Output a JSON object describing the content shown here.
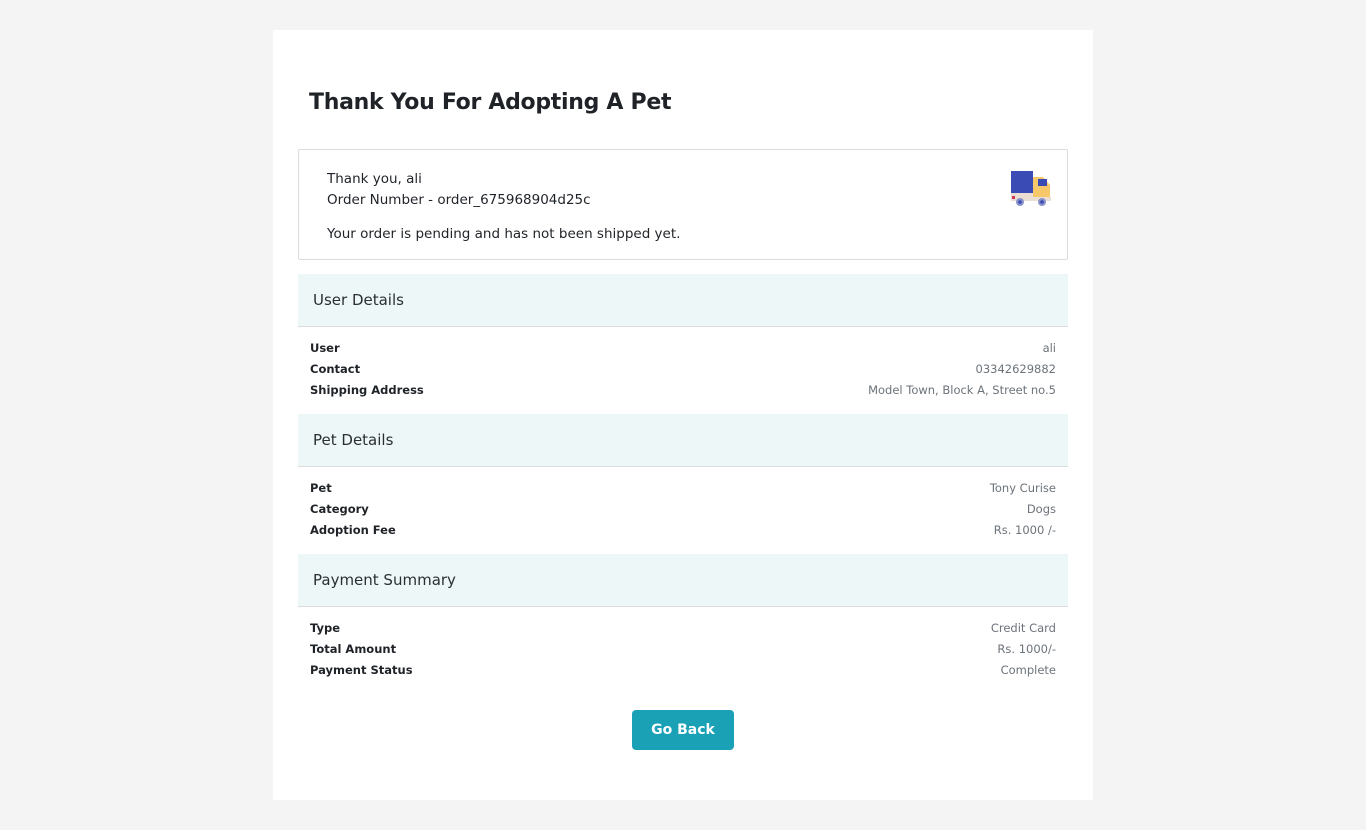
{
  "page": {
    "title": "Thank You For Adopting A Pet"
  },
  "order": {
    "thank_you": "Thank you, ali",
    "order_number": "Order Number - order_675968904d25c",
    "status_message": "Your order is pending and has not been shipped yet.",
    "icon": "delivery-truck-icon"
  },
  "user_details": {
    "heading": "User Details",
    "rows": [
      {
        "label": "User",
        "value": "ali"
      },
      {
        "label": "Contact",
        "value": "03342629882"
      },
      {
        "label": "Shipping Address",
        "value": "Model Town, Block A, Street no.5"
      }
    ]
  },
  "pet_details": {
    "heading": "Pet Details",
    "rows": [
      {
        "label": "Pet",
        "value": "Tony Curise"
      },
      {
        "label": "Category",
        "value": "Dogs"
      },
      {
        "label": "Adoption Fee",
        "value": "Rs. 1000 /-"
      }
    ]
  },
  "payment_summary": {
    "heading": "Payment Summary",
    "rows": [
      {
        "label": "Type",
        "value": "Credit Card"
      },
      {
        "label": "Total Amount",
        "value": "Rs. 1000/-"
      },
      {
        "label": "Payment Status",
        "value": "Complete"
      }
    ]
  },
  "actions": {
    "go_back_label": "Go Back"
  },
  "colors": {
    "page_bg": "#f4f4f4",
    "section_bg": "#edf7f8",
    "button_bg": "#1aa1b6",
    "value_text": "#6c737a"
  }
}
